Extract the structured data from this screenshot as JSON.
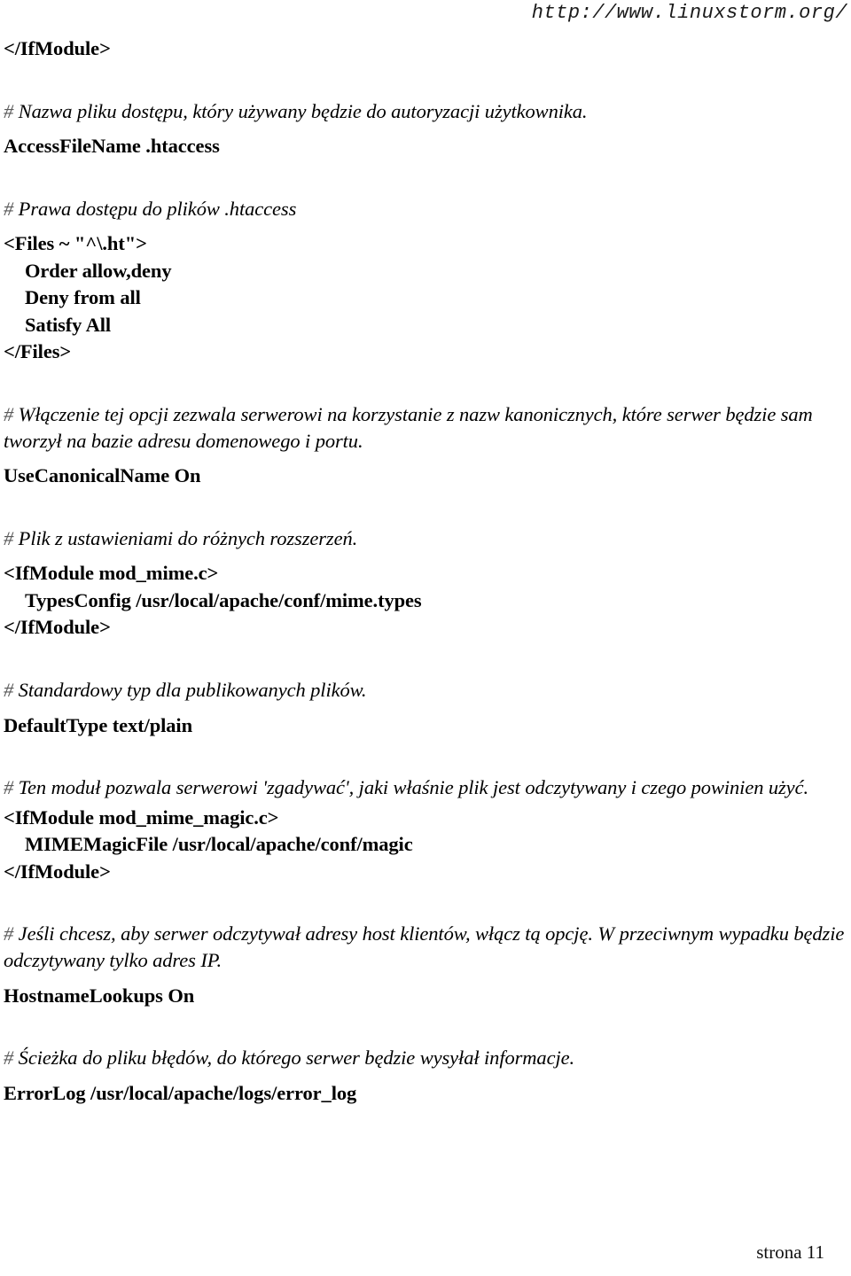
{
  "header": {
    "url": "http://www.linuxstorm.org/"
  },
  "footer": {
    "page_label": "strona 11"
  },
  "colors": {
    "text": "#000000",
    "hash": "#595959",
    "background": "#ffffff"
  },
  "document": {
    "language": "pl",
    "kind": "apache-httpd-config-tutorial"
  },
  "body": {
    "close_ifmodule_top": "</IfModule>",
    "comment_accessfilename": {
      "hash": "#",
      "text": " Nazwa pliku dostępu, który używany będzie do autoryzacji użytkownika."
    },
    "directive_accessfilename": "AccessFileName .htaccess",
    "comment_files_perms": {
      "hash": "#",
      "text": " Prawa dostępu do plików .htaccess"
    },
    "tag_files_open": "<Files ~ \"^\\.ht\">",
    "directive_order": "Order allow,deny",
    "directive_deny": "Deny from all",
    "directive_satisfy": "Satisfy All",
    "tag_files_close": "</Files>",
    "comment_canonical": {
      "hash": "#",
      "text": " Włączenie tej opcji zezwala serwerowi na korzystanie z nazw kanonicznych, które serwer będzie sam tworzył na bazie adresu domenowego i portu."
    },
    "directive_usecanonicalname": "UseCanonicalName On",
    "comment_mime": {
      "hash": "#",
      "text": " Plik z ustawieniami do różnych rozszerzeń."
    },
    "tag_ifmodule_mime_open": "<IfModule mod_mime.c>",
    "directive_typesconfig": "TypesConfig /usr/local/apache/conf/mime.types",
    "tag_ifmodule_mime_close": "</IfModule>",
    "comment_defaulttype": {
      "hash": "#",
      "text": " Standardowy typ dla publikowanych plików."
    },
    "directive_defaulttype": "DefaultType text/plain",
    "comment_mime_magic": {
      "hash": "#",
      "text": " Ten moduł pozwala serwerowi 'zgadywać', jaki właśnie plik jest odczytywany i czego powinien użyć."
    },
    "tag_ifmodule_magic_open": "<IfModule mod_mime_magic.c>",
    "directive_mimemagicfile": "MIMEMagicFile /usr/local/apache/conf/magic",
    "tag_ifmodule_magic_close": "</IfModule>",
    "comment_hostnamelookups": {
      "hash": "#",
      "text": " Jeśli chcesz, aby serwer odczytywał adresy host klientów, włącz tą opcję. W przeciwnym wypadku będzie odczytywany tylko adres IP."
    },
    "directive_hostnamelookups": "HostnameLookups On",
    "comment_errorlog": {
      "hash": "#",
      "text": " Ścieżka do pliku błędów, do którego serwer będzie wysyłał informacje."
    },
    "directive_errorlog": "ErrorLog /usr/local/apache/logs/error_log"
  }
}
